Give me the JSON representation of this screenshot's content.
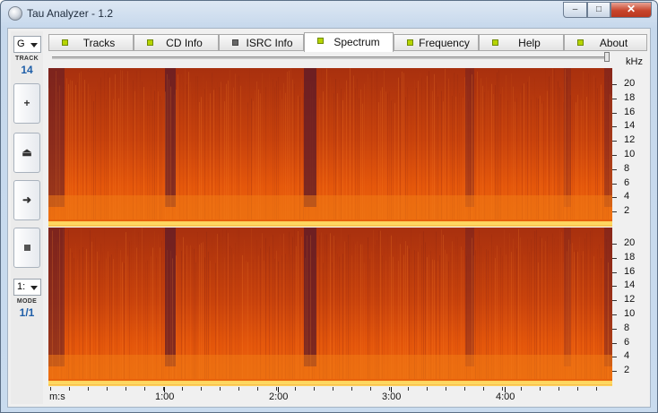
{
  "window": {
    "title": "Tau Analyzer - 1.2",
    "min_glyph": "‒",
    "max_glyph": "□",
    "close_glyph": "✕"
  },
  "leftbar": {
    "channel_combo": "G",
    "track_caption": "TRACK",
    "track_number": "14",
    "buttons": [
      {
        "name": "zoom-in-button",
        "glyph": "+",
        "icon": "plus-icon"
      },
      {
        "name": "eject-button",
        "glyph": "⏏",
        "icon": "eject-icon"
      },
      {
        "name": "forward-button",
        "glyph": "➜",
        "icon": "arrow-right-icon"
      },
      {
        "name": "stop-button",
        "glyph": "",
        "icon": "stop-square-icon"
      }
    ],
    "mode_combo": "1:",
    "mode_caption": "MODE",
    "mode_value": "1/1"
  },
  "tabs": [
    {
      "label": "Tracks",
      "led": "green",
      "active": false
    },
    {
      "label": "CD Info",
      "led": "green",
      "active": false
    },
    {
      "label": "ISRC Info",
      "led": "gray",
      "active": false
    },
    {
      "label": "Spectrum",
      "led": "green",
      "active": true
    },
    {
      "label": "Frequency",
      "led": "green",
      "active": false
    },
    {
      "label": "Help",
      "led": "green",
      "active": false
    },
    {
      "label": "About",
      "led": "green",
      "active": false
    }
  ],
  "spectrum": {
    "freq_unit": "kHz",
    "freq_ticks": [
      "20",
      "18",
      "16",
      "14",
      "12",
      "10",
      "8",
      "6",
      "4",
      "2"
    ],
    "time_unit": "m:s",
    "time_ticks": [
      "1:00",
      "2:00",
      "3:00",
      "4:00"
    ],
    "colors": {
      "high": "#ffe066",
      "mid": "#e8620a",
      "low": "#a8300e",
      "dark": "#5a1a2a"
    }
  }
}
